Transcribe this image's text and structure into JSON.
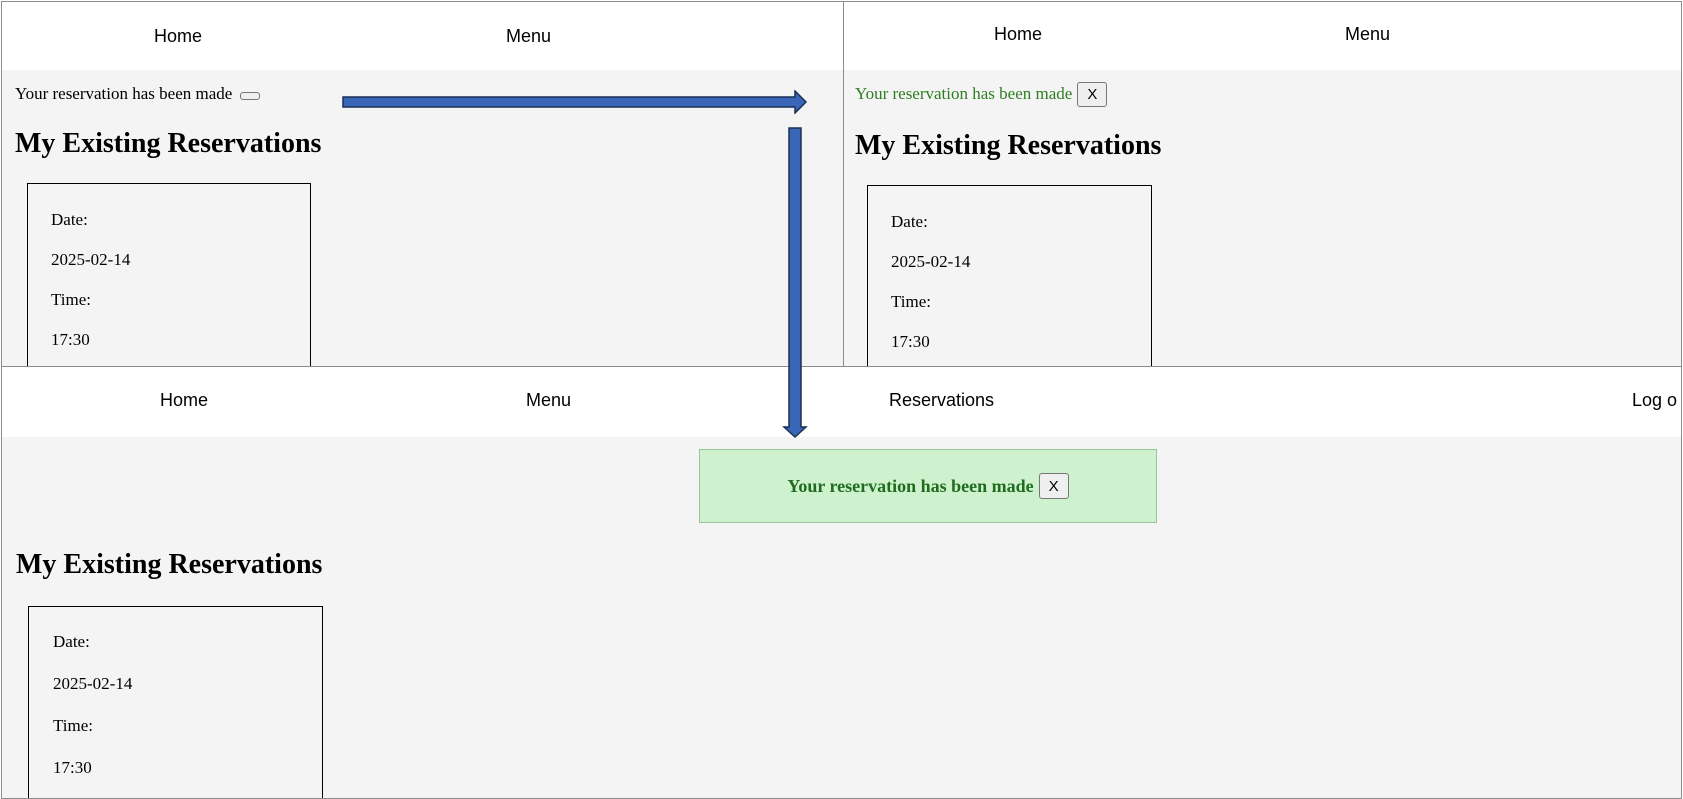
{
  "nav": {
    "home": "Home",
    "menu": "Menu",
    "reservations": "Reservations",
    "logout_partial": "Log o"
  },
  "message": "Your reservation has been made",
  "close_label": "X",
  "heading": "My Existing Reservations",
  "reservation": {
    "date_label": "Date:",
    "date": "2025-02-14",
    "time_label": "Time:",
    "time": "17:30"
  },
  "colors": {
    "success_text": "#2e7d22",
    "success_bg": "#cdf2cd",
    "success_border": "#9cc49c",
    "arrow_fill": "#3a66b8",
    "arrow_stroke": "#1b2f55"
  }
}
